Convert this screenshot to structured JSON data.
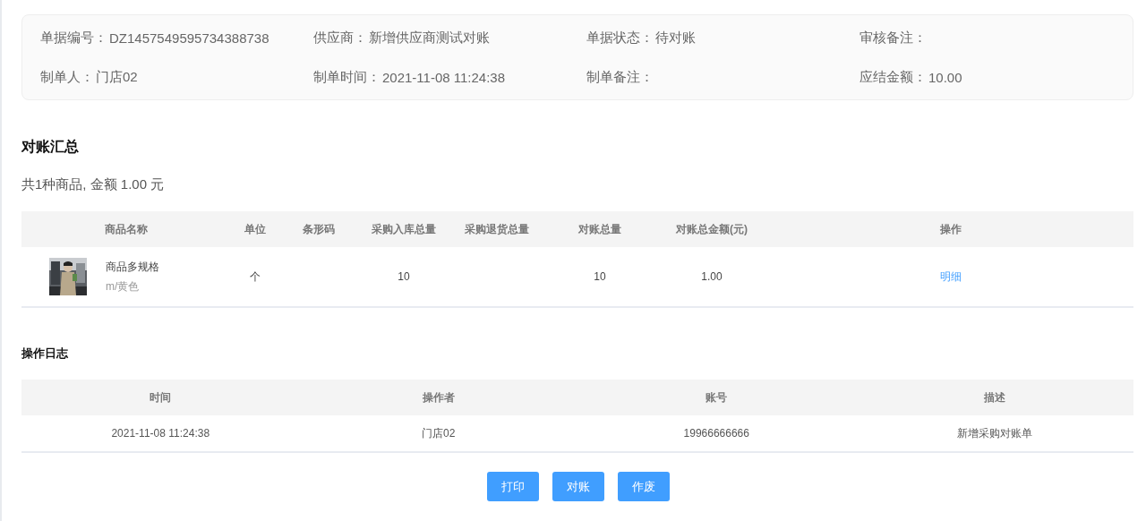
{
  "info": [
    {
      "label": "单据编号：",
      "value": "DZ1457549595734388738"
    },
    {
      "label": "供应商：",
      "value": "新增供应商测试对账"
    },
    {
      "label": "单据状态：",
      "value": "待对账"
    },
    {
      "label": "审核备注："
    },
    {
      "label": "制单人：",
      "value": "门店02"
    },
    {
      "label": "制单时间：",
      "value": "2021-11-08 11:24:38"
    },
    {
      "label": "制单备注："
    },
    {
      "label": "应结金额：",
      "value": "10.00"
    }
  ],
  "summary": {
    "title": "对账汇总",
    "totals": "共1种商品, 金额 1.00 元",
    "columns": [
      "商品名称",
      "单位",
      "条形码",
      "采购入库总量",
      "采购退货总量",
      "对账总量",
      "对账总金额(元)",
      "操作"
    ],
    "rows": [
      {
        "name": "商品多规格",
        "spec": "m/黄色",
        "unit": "个",
        "in_qty": "10",
        "recon_qty": "10",
        "amount": "1.00",
        "action": "明细"
      }
    ]
  },
  "log": {
    "title": "操作日志",
    "columns": [
      "时间",
      "操作者",
      "账号",
      "描述"
    ],
    "rows": [
      [
        "2021-11-08 11:24:38",
        "门店02",
        "19966666666",
        "新增采购对账单"
      ]
    ]
  },
  "buttons": [
    "打印",
    "对账",
    "作废"
  ]
}
